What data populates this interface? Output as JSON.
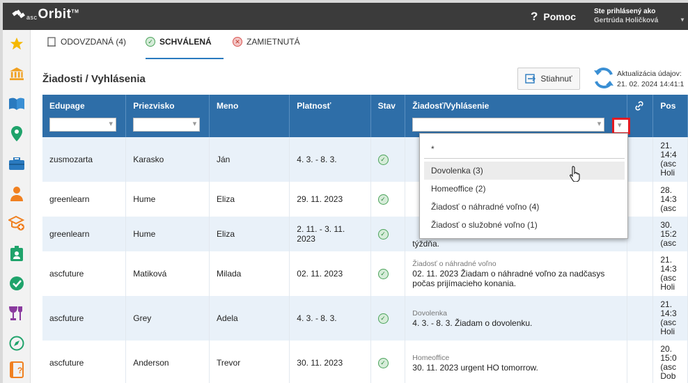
{
  "app": {
    "logo_prefix": "asc",
    "logo_name": "Orbit",
    "logo_tm": "TM"
  },
  "topbar": {
    "help_label": "Pomoc",
    "user_label": "Ste prihlásený ako",
    "user_name": "Gertrúda Holičková"
  },
  "tabs": [
    {
      "label": "ODOVZDANÁ (4)",
      "icon": "document-icon",
      "active": false
    },
    {
      "label": "SCHVÁLENÁ",
      "icon": "check-circle-icon",
      "active": true
    },
    {
      "label": "ZAMIETNUTÁ",
      "icon": "x-circle-icon",
      "active": false
    }
  ],
  "page": {
    "title": "Žiadosti / Vyhlásenia",
    "download_label": "Stiahnuť",
    "update_label": "Aktualizácia údajov:",
    "update_value": "21. 02. 2024 14:41:1"
  },
  "table": {
    "headers": [
      "Edupage",
      "Priezvisko",
      "Meno",
      "Platnosť",
      "Stav",
      "Žiadosť/Vyhlásenie",
      "",
      "Pos"
    ],
    "rows": [
      {
        "edupage": "zusmozarta",
        "priezvisko": "Karasko",
        "meno": "Ján",
        "platnost": "4. 3. - 8. 3.",
        "req_type": "",
        "req_text": "",
        "post": [
          "21.",
          "14:4",
          "(asc",
          "Holi"
        ]
      },
      {
        "edupage": "greenlearn",
        "priezvisko": "Hume",
        "meno": "Eliza",
        "platnost": "29. 11. 2023",
        "req_type": "",
        "req_text": "",
        "post": [
          "28.",
          "14:3",
          "(asc"
        ]
      },
      {
        "edupage": "greenlearn",
        "priezvisko": "Hume",
        "meno": "Eliza",
        "platnost": "2. 11. - 3. 11. 2023",
        "req_type": "",
        "req_text": "týždňa.",
        "post": [
          "30.",
          "15:2",
          "(asc"
        ]
      },
      {
        "edupage": "ascfuture",
        "priezvisko": "Matiková",
        "meno": "Milada",
        "platnost": "02. 11. 2023",
        "req_type": "Žiadosť o náhradné voľno",
        "req_text": "02. 11. 2023 Žiadam o náhradné voľno za nadčasys počas prijímacieho konania.",
        "post": [
          "21.",
          "14:3",
          "(asc",
          "Holi"
        ]
      },
      {
        "edupage": "ascfuture",
        "priezvisko": "Grey",
        "meno": "Adela",
        "platnost": "4. 3. - 8. 3.",
        "req_type": "Dovolenka",
        "req_text": "4. 3. - 8. 3. Žiadam o dovolenku.",
        "post": [
          "21.",
          "14:3",
          "(asc",
          "Holi"
        ]
      },
      {
        "edupage": "ascfuture",
        "priezvisko": "Anderson",
        "meno": "Trevor",
        "platnost": "30. 11. 2023",
        "req_type": "Homeoffice",
        "req_text": "30. 11. 2023 urgent HO tomorrow.",
        "post": [
          "20.",
          "15:0",
          "(asc",
          "Dob"
        ]
      }
    ]
  },
  "dropdown": {
    "search_value": "*",
    "options": [
      "Dovolenka (3)",
      "Homeoffice (2)",
      "Žiadosť o náhradné voľno (4)",
      "Žiadosť o služobné voľno (1)"
    ],
    "hovered_index": 0
  },
  "sidebar": {
    "icons": [
      "star-icon",
      "bank-icon",
      "book-icon",
      "location-pin-icon",
      "briefcase-icon",
      "person-icon",
      "school-add-icon",
      "badge-icon",
      "check-badge-icon",
      "trophy-food-icon",
      "compass-icon",
      "book-question-icon"
    ]
  },
  "colors": {
    "header_blue": "#2e6ea8",
    "row_alt": "#e9f1f9",
    "accent": "#2a7abf",
    "highlight_red": "#e31b23",
    "icon_orange": "#f0a020",
    "icon_green": "#1fa36b"
  }
}
